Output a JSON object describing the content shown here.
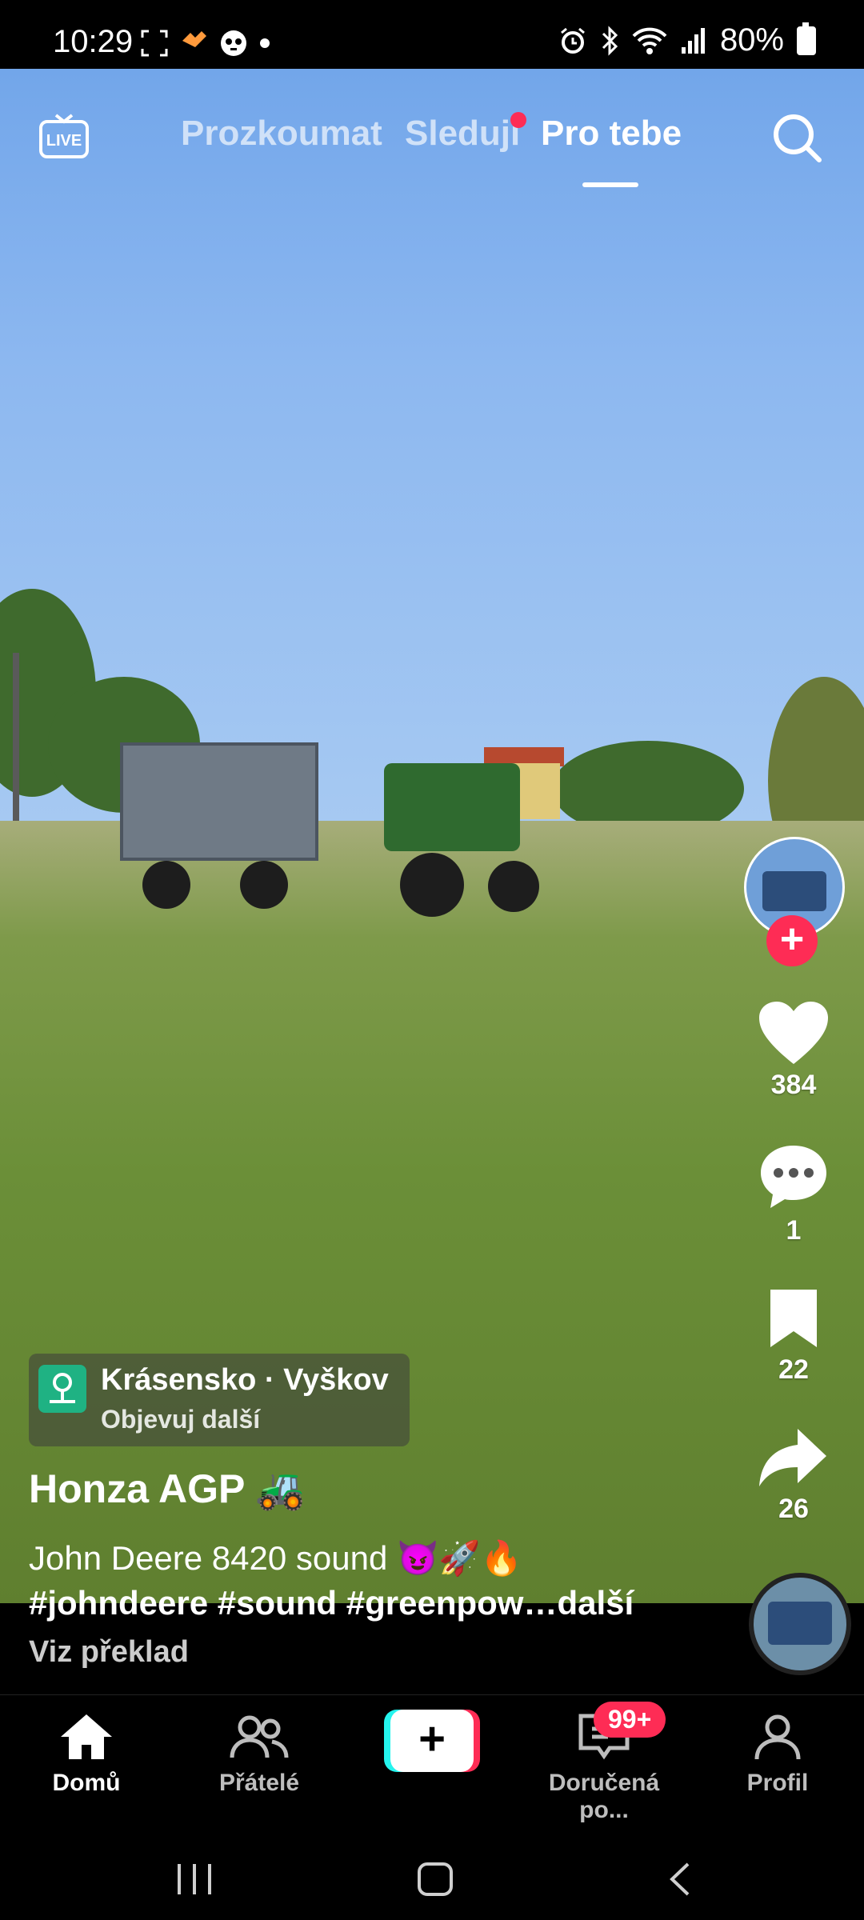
{
  "status_bar": {
    "time": "10:29",
    "battery": "80%",
    "icons_left": [
      "screenshot-icon",
      "tiktok-heart-icon",
      "panda-icon",
      "dot-icon"
    ],
    "icons_right": [
      "alarm-icon",
      "bluetooth-icon",
      "wifi-icon",
      "signal-icon",
      "battery-icon"
    ]
  },
  "top_nav": {
    "live_label": "LIVE",
    "tabs": [
      {
        "label": "Prozkoumat",
        "active": false
      },
      {
        "label": "Sleduji",
        "active": false,
        "dot": true
      },
      {
        "label": "Pro tebe",
        "active": true
      }
    ],
    "search_icon": "search-icon"
  },
  "right_rail": {
    "likes": "384",
    "comments": "1",
    "saves": "22",
    "shares": "26",
    "follow_symbol": "+"
  },
  "location": {
    "place": "Krásensko · Vyškov",
    "subtitle": "Objevuj další"
  },
  "post": {
    "author": "Honza AGP 🚜",
    "caption_line1": "John Deere 8420 sound 😈🚀🔥",
    "caption_line2": "#johndeere #sound #greenpow…",
    "more": "další",
    "translate": "Viz překlad"
  },
  "bottom_nav": {
    "home": "Domů",
    "friends": "Přátelé",
    "create": "+",
    "inbox": "Doručená po...",
    "inbox_badge": "99+",
    "profile": "Profil"
  },
  "colors": {
    "accent": "#fe2c55",
    "cyan": "#25f4ee",
    "location_green": "#1fb283"
  }
}
